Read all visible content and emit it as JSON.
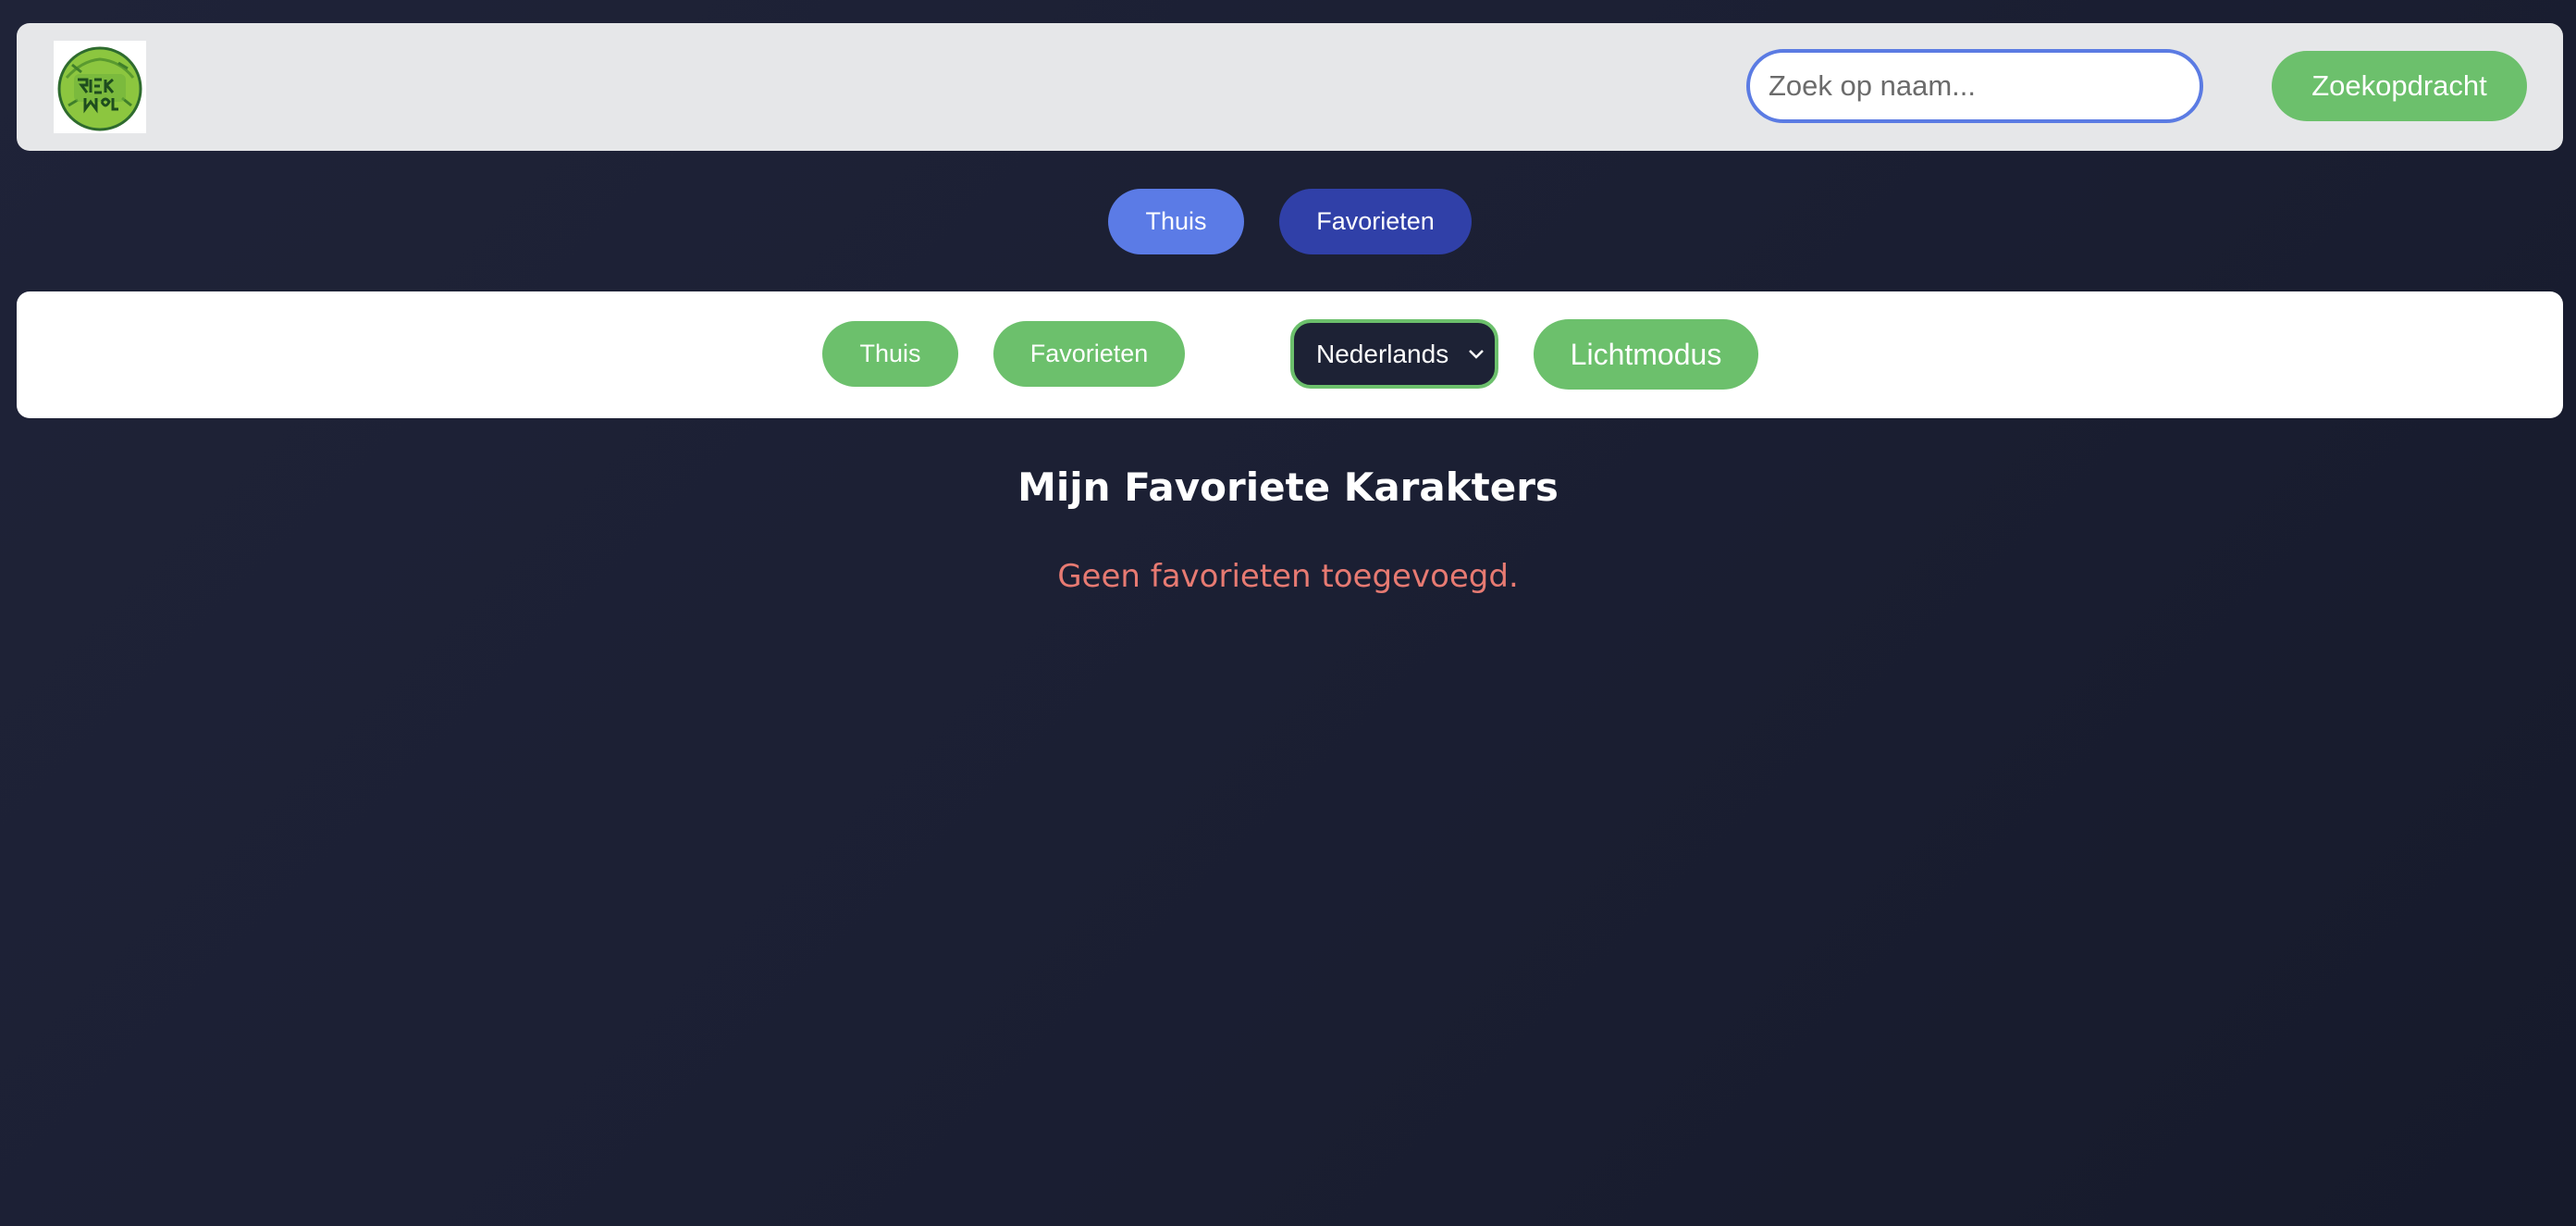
{
  "header": {
    "logo_alt": "Rick and Morty",
    "search": {
      "placeholder": "Zoek op naam...",
      "value": ""
    },
    "search_button_label": "Zoekopdracht"
  },
  "nav_primary": {
    "home_label": "Thuis",
    "favorites_label": "Favorieten"
  },
  "toolbar": {
    "home_label": "Thuis",
    "favorites_label": "Favorieten",
    "language_select": {
      "selected": "Nederlands"
    },
    "theme_toggle_label": "Lichtmodus"
  },
  "main": {
    "title": "Mijn Favoriete Karakters",
    "empty_message": "Geen favorieten toegevoegd."
  },
  "colors": {
    "background": "#1b1f33",
    "header_bg": "#e6e7e9",
    "accent_green": "#6cc06c",
    "accent_blue": "#5b7be6",
    "accent_blue_dark": "#3040a8",
    "error_text": "#e77a72"
  }
}
